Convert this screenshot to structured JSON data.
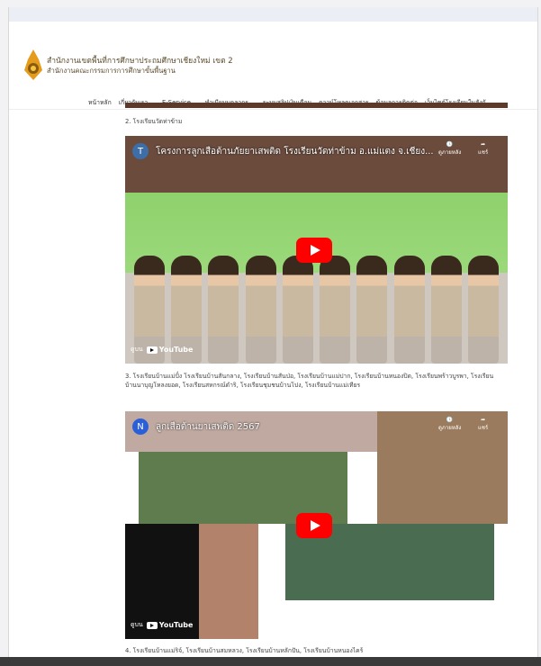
{
  "header": {
    "org_line1": "สำนักงานเขตพื้นที่การศึกษาประถมศึกษาเชียงใหม่ เขต 2",
    "org_line2": "สำนักงานคณะกรรมการการศึกษาขั้นพื้นฐาน"
  },
  "nav": [
    "หน้าหลัก",
    "เกี่ยวกับเรา ⌄",
    "E-Service ⌄",
    "ทำเนียบบุคลากร ⌄",
    "ระบบสลิปเงินเดือน",
    "ดาวน์โหลดเอกสาร",
    "ข้อมูลการติดต่อ",
    "เว็บไซต์โรงเรียนในสังกั"
  ],
  "content": {
    "caption2": "2. โรงเรียนวัดท่าข้าม",
    "caption3": "3. โรงเรียนบ้านแม่ปั๋ง โรงเรียนบ้านสันกลาง, โรงเรียนบ้านสันป่อ, โรงเรียนบ้านแม่ปาก, โรงเรียนบ้านหนองปิด, โรงเรียนพร้าวบูรพา, โรงเรียนบ้านนาบุญโหลงยอด, โรงเรียนสหกรณ์ดำริ, โรงเรียนชุมชนบ้านโปง, โรงเรียนบ้านแม่เทียร",
    "caption4": "4. โรงเรียนบ้านแม่ริจ์, โรงเรียนบ้านสมหลวง, โรงเรียนบ้านหลักปัน, โรงเรียนบ้านหนองไคร้"
  },
  "video1": {
    "channel_initial": "T",
    "title": "โครงการลูกเสือต้านภัยยาเสพติด โรงเรียนวัดท่าข้าม อ.แม่แตง จ.เชียง...",
    "watch_later": "ดูภายหลัง",
    "share": "แชร์",
    "watch_on": "ดูบน",
    "youtube": "YouTube"
  },
  "video2": {
    "channel_initial": "N",
    "title": "ลูกเสือต้านยาเสพติด 2567",
    "watch_later": "ดูภายหลัง",
    "share": "แชร์",
    "watch_on": "ดูบน",
    "youtube": "YouTube"
  }
}
